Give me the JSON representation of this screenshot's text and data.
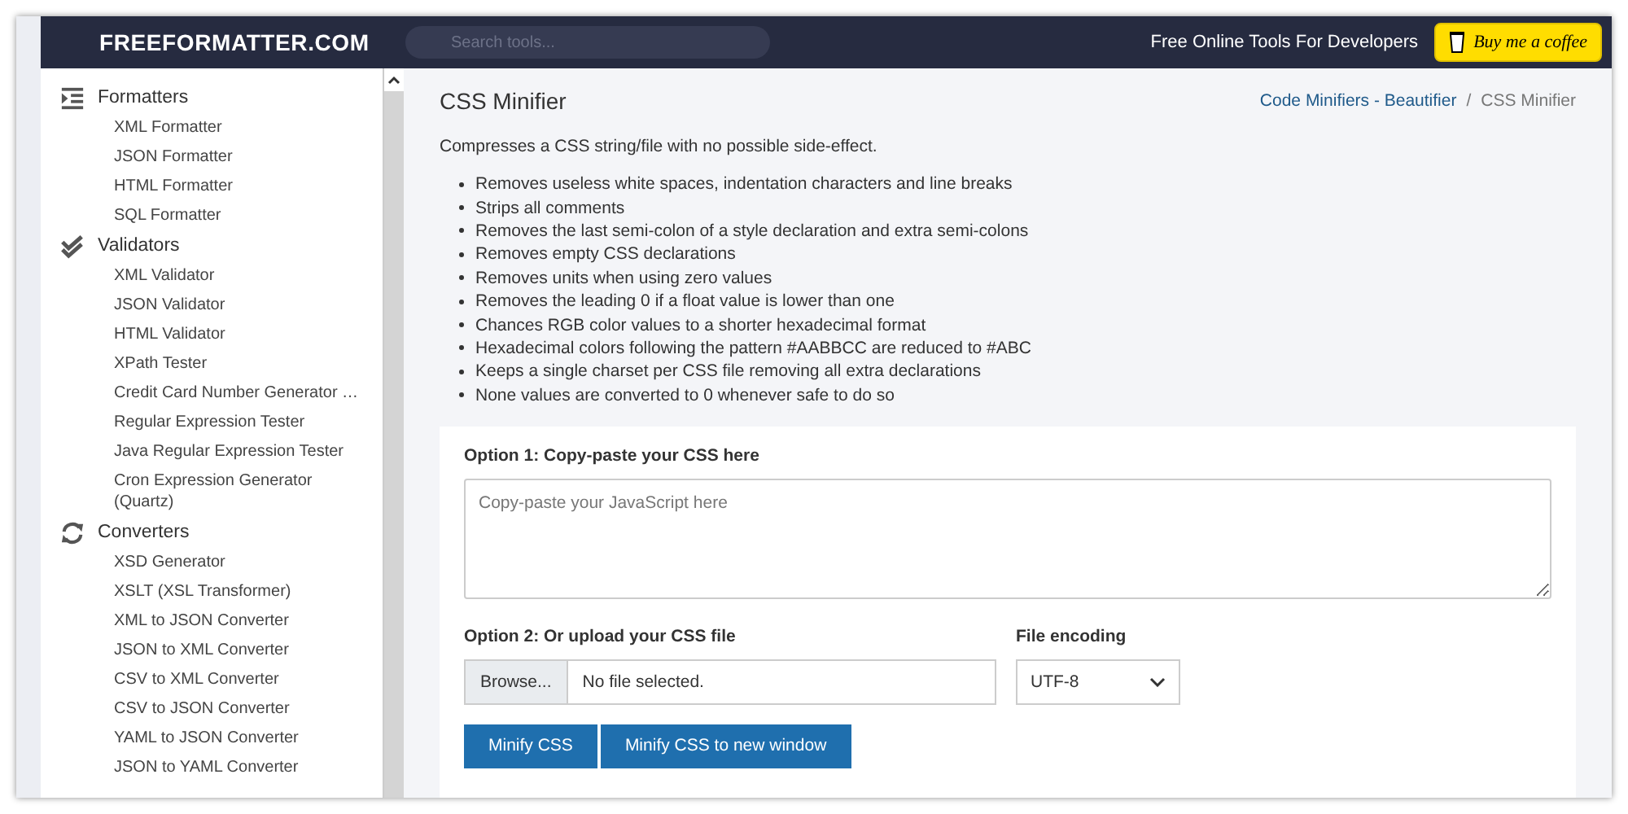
{
  "header": {
    "logo": "FREEFORMATTER.COM",
    "search": {
      "placeholder": "Search tools..."
    },
    "tagline": "Free Online Tools For Developers",
    "coffee_button": "Buy me a coffee"
  },
  "sidebar": {
    "groups": [
      {
        "kind": "indent",
        "label": "Formatters",
        "items": [
          "XML Formatter",
          "JSON Formatter",
          "HTML Formatter",
          "SQL Formatter"
        ]
      },
      {
        "kind": "check",
        "label": "Validators",
        "items": [
          "XML Validator",
          "JSON Validator",
          "HTML Validator",
          "XPath Tester",
          "Credit Card Number Generator …",
          "Regular Expression Tester",
          "Java Regular Expression Tester",
          "Cron Expression Generator (Quartz)"
        ]
      },
      {
        "kind": "refresh",
        "label": "Converters",
        "items": [
          "XSD Generator",
          "XSLT (XSL Transformer)",
          "XML to JSON Converter",
          "JSON to XML Converter",
          "CSV to XML Converter",
          "CSV to JSON Converter",
          "YAML to JSON Converter",
          "JSON to YAML Converter"
        ]
      }
    ]
  },
  "page": {
    "title": "CSS Minifier",
    "breadcrumb": {
      "link": "Code Minifiers - Beautifier",
      "separator": "/",
      "current": "CSS Minifier"
    },
    "description": "Compresses a CSS string/file with no possible side-effect.",
    "features": [
      "Removes useless white spaces, indentation characters and line breaks",
      "Strips all comments",
      "Removes the last semi-colon of a style declaration and extra semi-colons",
      "Removes empty CSS declarations",
      "Removes units when using zero values",
      "Removes the leading 0 if a float value is lower than one",
      "Chances RGB color values to a shorter hexadecimal format",
      "Hexadecimal colors following the pattern #AABBCC are reduced to #ABC",
      "Keeps a single charset per CSS file removing all extra declarations",
      "None values are converted to 0 whenever safe to do so"
    ]
  },
  "form": {
    "option1_label": "Option 1: Copy-paste your CSS here",
    "textarea": {
      "placeholder": "Copy-paste your JavaScript here"
    },
    "option2_label": "Option 2: Or upload your CSS file",
    "file": {
      "button": "Browse...",
      "status": "No file selected."
    },
    "encoding": {
      "label": "File encoding",
      "value": "UTF-8"
    },
    "buttons": [
      "Minify CSS",
      "Minify CSS to new window"
    ]
  }
}
